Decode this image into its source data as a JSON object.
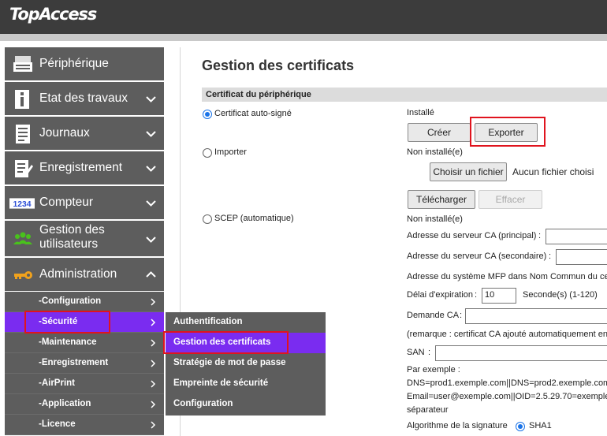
{
  "app": {
    "logo": "TopAccess"
  },
  "nav": {
    "items": [
      {
        "label": "Périphérique",
        "icon": "printer-icon"
      },
      {
        "label": "Etat des travaux",
        "icon": "info-icon"
      },
      {
        "label": "Journaux",
        "icon": "log-icon"
      },
      {
        "label": "Enregistrement",
        "icon": "register-icon"
      },
      {
        "label": "Compteur",
        "icon": "counter-icon",
        "icon_text": "1234"
      },
      {
        "label": "Gestion des utilisateurs",
        "icon": "users-icon"
      },
      {
        "label": "Administration",
        "icon": "key-icon"
      }
    ],
    "admin_sub": [
      {
        "label": "-Configuration"
      },
      {
        "label": "-Sécurité",
        "active": true
      },
      {
        "label": "-Maintenance"
      },
      {
        "label": "-Enregistrement"
      },
      {
        "label": "-AirPrint"
      },
      {
        "label": "-Application"
      },
      {
        "label": "-Licence"
      }
    ]
  },
  "flyout": {
    "items": [
      {
        "label": "Authentification"
      },
      {
        "label": "Gestion des certificats",
        "active": true
      },
      {
        "label": "Stratégie de mot de passe"
      },
      {
        "label": "Empreinte de sécurité"
      },
      {
        "label": "Configuration"
      }
    ]
  },
  "main": {
    "title": "Gestion des certificats",
    "section": "Certificat du périphérique",
    "self_signed": {
      "label": "Certificat auto-signé",
      "status": "Installé",
      "create_button": "Créer",
      "export_button": "Exporter"
    },
    "import": {
      "label": "Importer",
      "status": "Non installé(e)",
      "choose_button": "Choisir un fichier",
      "no_file": "Aucun fichier choisi",
      "upload_button": "Télécharger",
      "clear_button": "Effacer"
    },
    "scep": {
      "label": "SCEP (automatique)",
      "status": "Non installé(e)",
      "ca_primary_label": "Adresse du serveur CA (principal)",
      "ca_secondary_label": "Adresse du serveur CA (secondaire)",
      "mfp_address_label": "Adresse du système MFP dans Nom Commun du ce",
      "expiry_label": "Délai d'expiration",
      "expiry_value": "10",
      "expiry_unit": "Seconde(s) (1-120)",
      "ca_request_label": "Demande CA",
      "remark": "(remarque : certificat CA ajouté automatiquement en",
      "san_label": "SAN",
      "example_title": "Par exemple :",
      "example_line1": "DNS=prod1.exemple.com||DNS=prod2.exemple.com",
      "example_line2": "Email=user@exemple.com||OID=2.5.29.70=exemple",
      "example_line3": "séparateur",
      "signature_label": "Algorithme de la signature",
      "signature_value": "SHA1"
    },
    "colon": ":"
  },
  "colors": {
    "accent": "#7a2cf0",
    "nav_bg": "#5d5d5d",
    "highlight": "#e0141e",
    "topbar": "#3c3c3c"
  }
}
